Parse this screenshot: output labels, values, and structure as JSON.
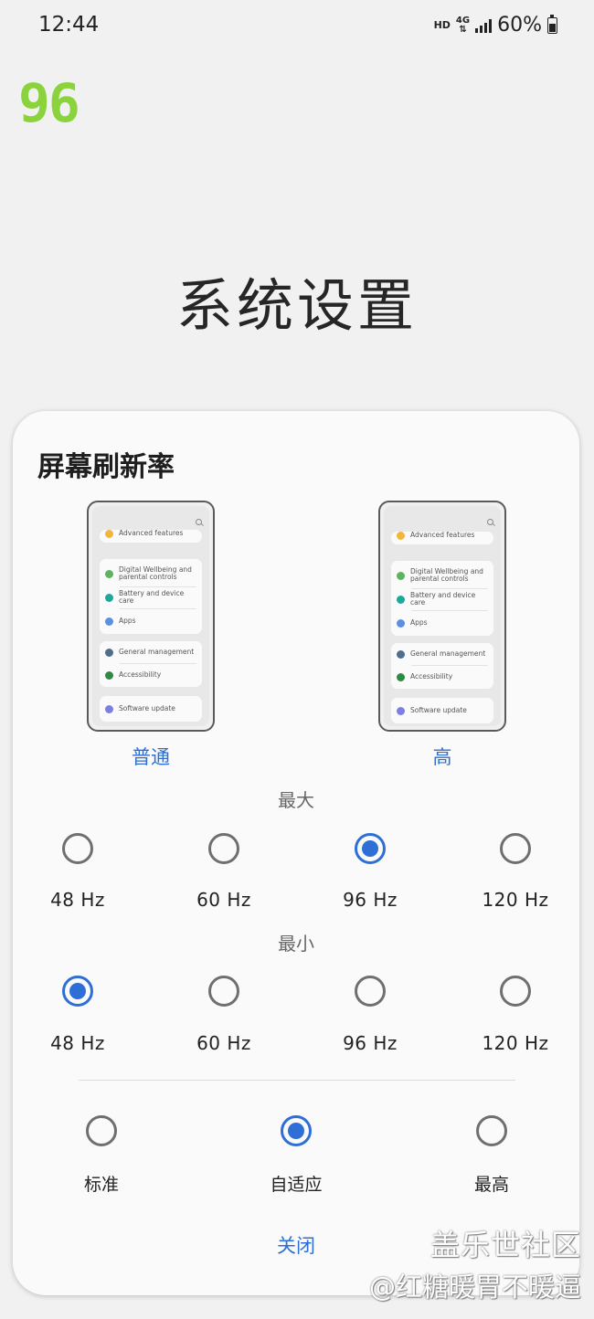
{
  "status_bar": {
    "time": "12:44",
    "hd": "HD",
    "network": "4G",
    "battery": "60%"
  },
  "logo_text": "96",
  "page_title": "系统设置",
  "dialog": {
    "title": "屏幕刷新率",
    "preview_items": {
      "top": "Advanced features",
      "wellbeing": "Digital Wellbeing and parental controls",
      "battery": "Battery and device care",
      "apps": "Apps",
      "general": "General management",
      "accessibility": "Accessibility",
      "software": "Software update"
    },
    "preview_options": [
      "普通",
      "高"
    ],
    "max_label": "最大",
    "min_label": "最小",
    "max_rates": [
      {
        "label": "48 Hz",
        "selected": false
      },
      {
        "label": "60 Hz",
        "selected": false
      },
      {
        "label": "96 Hz",
        "selected": true
      },
      {
        "label": "120 Hz",
        "selected": false
      }
    ],
    "min_rates": [
      {
        "label": "48 Hz",
        "selected": true
      },
      {
        "label": "60 Hz",
        "selected": false
      },
      {
        "label": "96 Hz",
        "selected": false
      },
      {
        "label": "120 Hz",
        "selected": false
      }
    ],
    "modes": [
      {
        "label": "标准",
        "selected": false
      },
      {
        "label": "自适应",
        "selected": true
      },
      {
        "label": "最高",
        "selected": false
      }
    ],
    "close_label": "关闭"
  },
  "watermark": {
    "site": "盖乐世社区",
    "user": "@红糖暖胃不暖逼"
  },
  "colors": {
    "accent": "#2d6fd6",
    "logo": "#8bd33d"
  }
}
